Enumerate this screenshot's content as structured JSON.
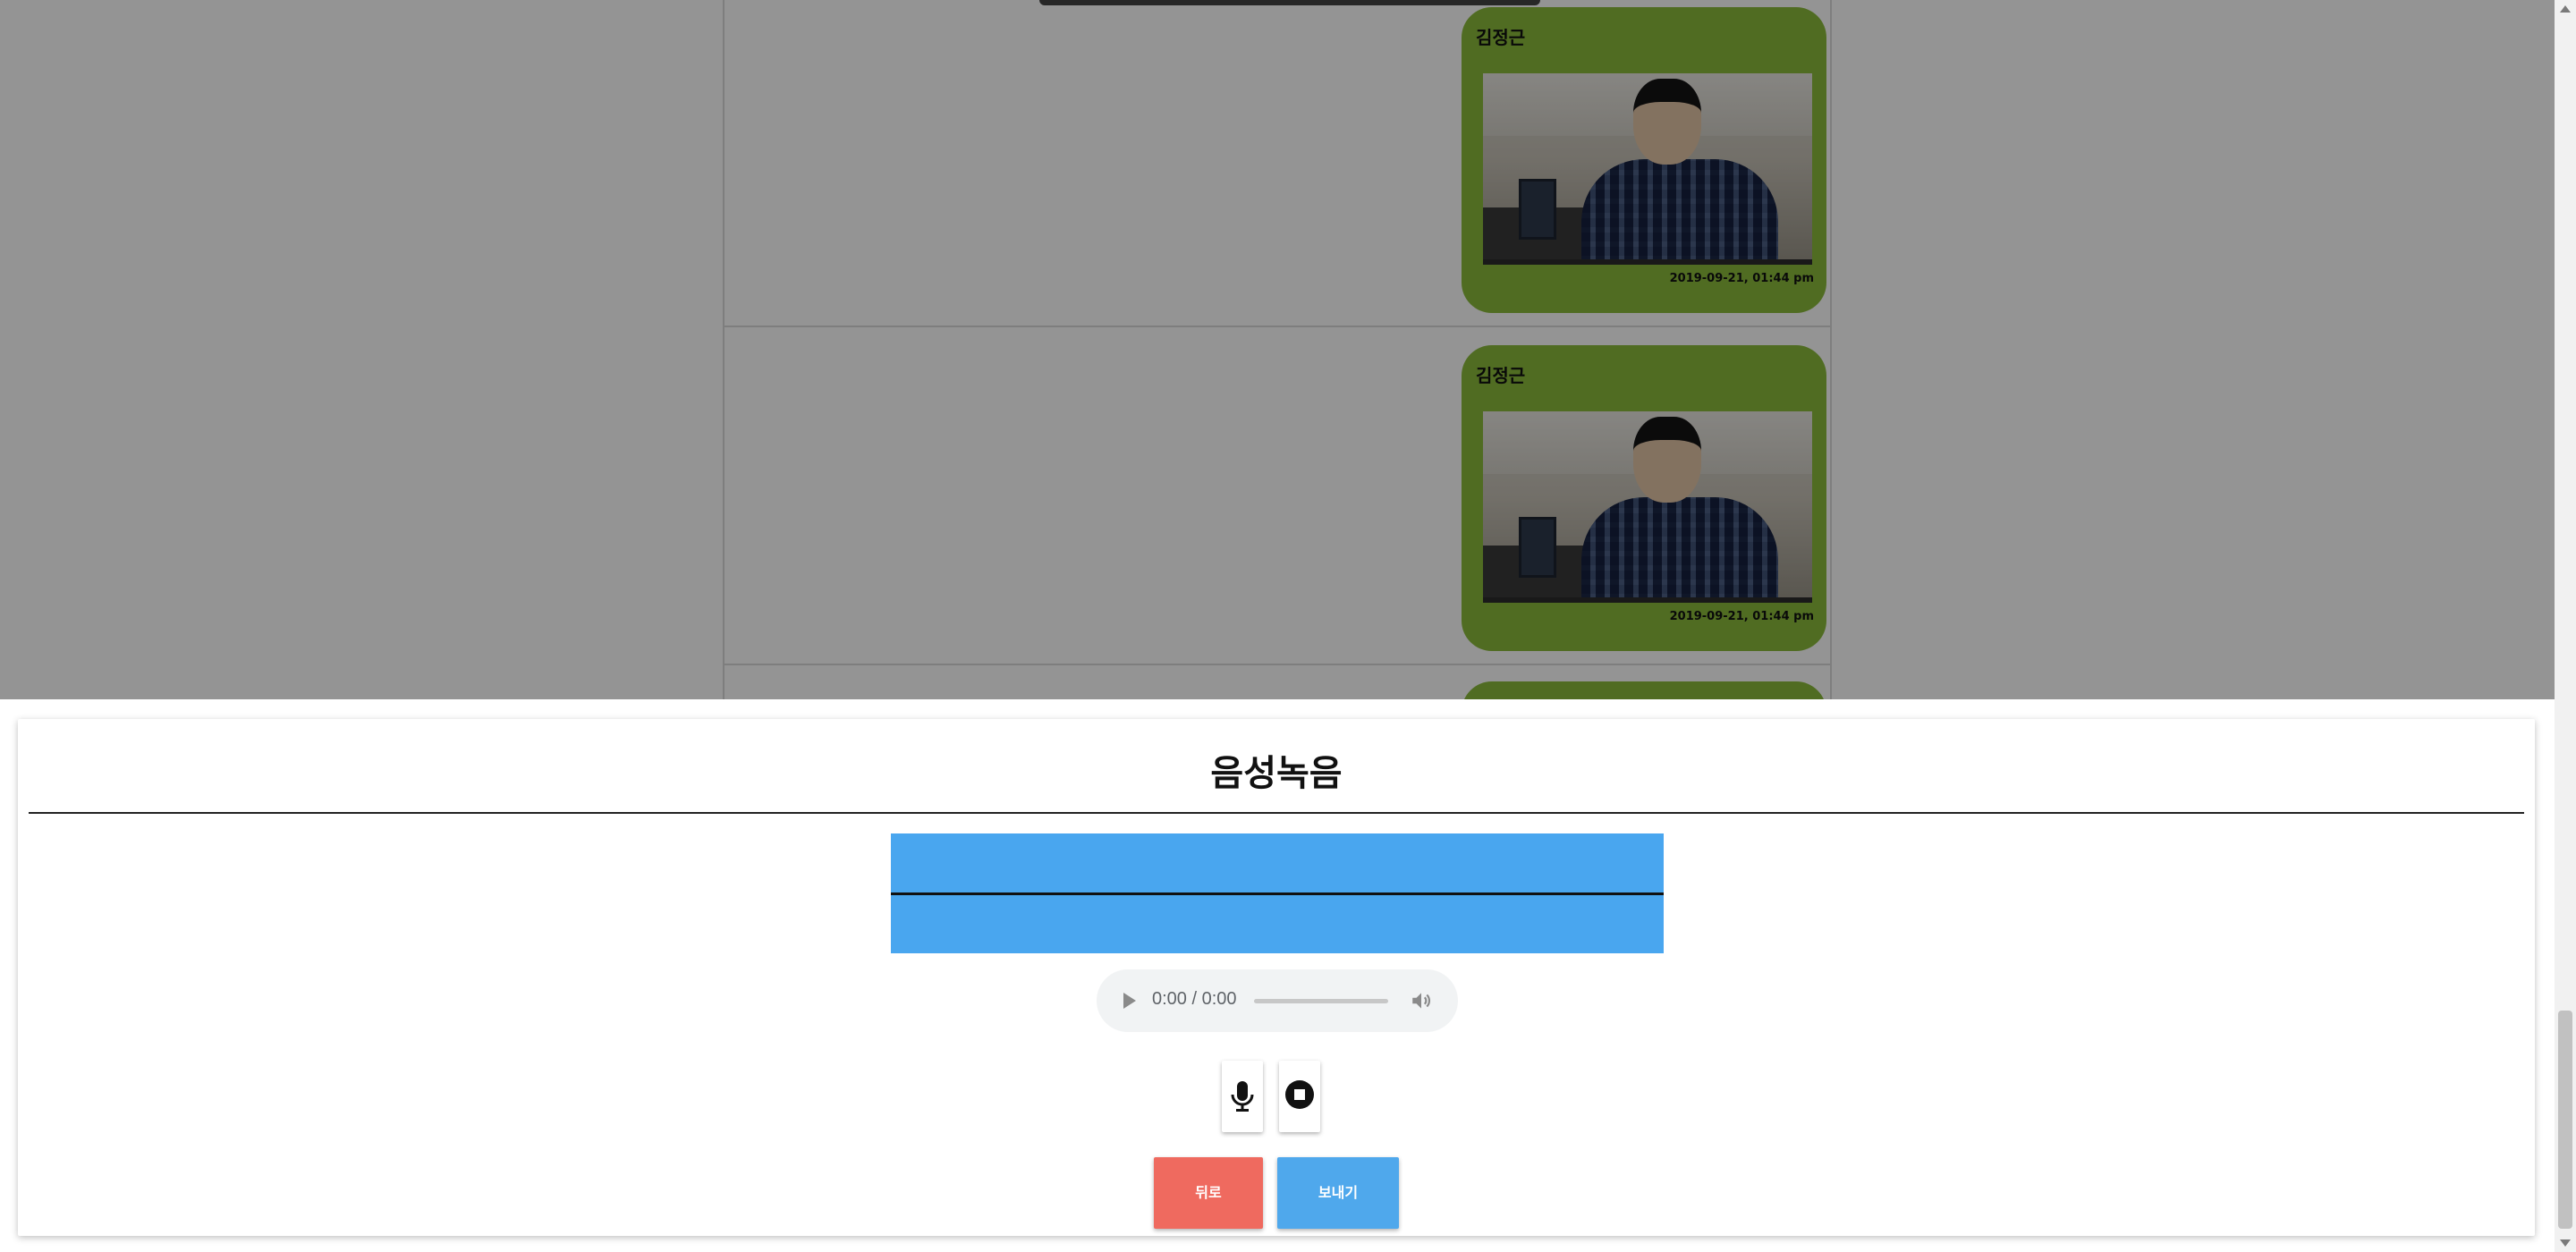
{
  "chat": {
    "messages": [
      {
        "sender": "김정근",
        "timestamp": "2019-09-21, 01:44 pm"
      },
      {
        "sender": "김정근",
        "timestamp": "2019-09-21, 01:44 pm"
      }
    ]
  },
  "recorder": {
    "title": "음성녹음",
    "player_time": "0:00 / 0:00",
    "back_label": "뒤로",
    "send_label": "보내기"
  },
  "icons": {
    "play": "play-icon",
    "volume": "volume-icon",
    "mic": "microphone-icon",
    "stop": "stop-icon"
  },
  "colors": {
    "bubble": "#8bbb3c",
    "waveform": "#49a6ef",
    "back_button": "#ef6a5f",
    "send_button": "#4fa8ec"
  }
}
